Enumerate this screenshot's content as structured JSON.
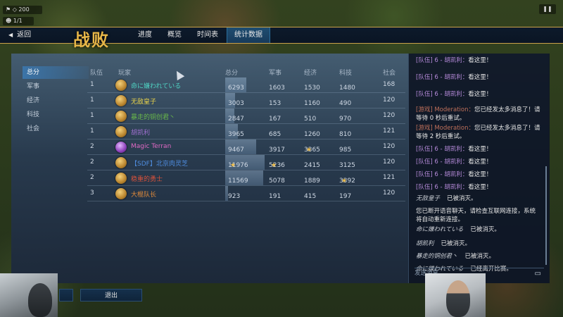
{
  "header": {
    "back_label": "返回",
    "defeat_title": "战败",
    "tabs": [
      {
        "label": "进度",
        "active": false
      },
      {
        "label": "概览",
        "active": false
      },
      {
        "label": "时间表",
        "active": false
      },
      {
        "label": "统计数据",
        "active": true
      }
    ]
  },
  "top_left": {
    "resource1": "200",
    "resource2": "1/1"
  },
  "sidebar": {
    "items": [
      {
        "label": "总分",
        "active": true
      },
      {
        "label": "军事",
        "active": false
      },
      {
        "label": "经济",
        "active": false
      },
      {
        "label": "科技",
        "active": false
      },
      {
        "label": "社会",
        "active": false
      }
    ]
  },
  "table": {
    "headers": {
      "team": "队伍",
      "player": "玩家",
      "total": "总分",
      "military": "军事",
      "economy": "经济",
      "tech": "科技",
      "society": "社会"
    },
    "rows": [
      {
        "team": "1",
        "player": "命に嫌われている",
        "player_color": "#4fd3c3",
        "medal": "gold",
        "total": "6293",
        "total_bar": 0.53,
        "military": "1603",
        "economy": "1530",
        "tech": "1480",
        "society": "168",
        "economy_star": false,
        "military_star": false,
        "tech_star": false,
        "total_star": false
      },
      {
        "team": "1",
        "player": "无敌皇子",
        "player_color": "#e9d34a",
        "medal": "gold",
        "total": "3003",
        "total_bar": 0.25,
        "military": "153",
        "economy": "1160",
        "tech": "490",
        "society": "120",
        "economy_star": false,
        "military_star": false,
        "tech_star": false,
        "total_star": false
      },
      {
        "team": "1",
        "player": "暴走的铜创君丶",
        "player_color": "#69b84a",
        "medal": "gold",
        "total": "2847",
        "total_bar": 0.24,
        "military": "167",
        "economy": "510",
        "tech": "970",
        "society": "120",
        "economy_star": false,
        "military_star": false,
        "tech_star": false,
        "total_star": false
      },
      {
        "team": "1",
        "player": "胡凯利",
        "player_color": "#a06fd0",
        "medal": "gold",
        "total": "3965",
        "total_bar": 0.33,
        "military": "685",
        "economy": "1260",
        "tech": "810",
        "society": "121",
        "economy_star": false,
        "military_star": false,
        "tech_star": false,
        "total_star": false
      },
      {
        "team": "2",
        "player": "Magic Terran",
        "player_color": "#e069c4",
        "medal": "purple",
        "total": "9467",
        "total_bar": 0.79,
        "military": "3917",
        "economy": "3365",
        "tech": "985",
        "society": "120",
        "economy_star": true,
        "military_star": false,
        "tech_star": false,
        "total_star": false
      },
      {
        "team": "2",
        "player": "【SDF】北京肉灵芝",
        "player_color": "#4f8de0",
        "medal": "gold",
        "total": "11976",
        "total_bar": 1.0,
        "military": "5236",
        "economy": "2415",
        "tech": "3125",
        "society": "120",
        "economy_star": false,
        "military_star": true,
        "tech_star": false,
        "total_star": true
      },
      {
        "team": "2",
        "player": "稳重的勇士",
        "player_color": "#d8513b",
        "medal": "gold",
        "total": "11569",
        "total_bar": 0.97,
        "military": "5078",
        "economy": "1889",
        "tech": "3392",
        "society": "121",
        "economy_star": false,
        "military_star": false,
        "tech_star": true,
        "total_star": false
      },
      {
        "team": "3",
        "player": "大棍队长",
        "player_color": "#e08a3a",
        "medal": "gold",
        "total": "923",
        "total_bar": 0.08,
        "military": "191",
        "economy": "415",
        "tech": "197",
        "society": "120",
        "economy_star": false,
        "military_star": false,
        "tech_star": false,
        "total_star": false
      }
    ]
  },
  "chat": {
    "messages": [
      {
        "tag": "[队伍] 6 - 胡凯利：",
        "text": "看这里！",
        "kind": "team"
      },
      {
        "tag": "[队伍] 6 - 胡凯利：",
        "text": "看这里！",
        "kind": "team"
      },
      {
        "tag": "[队伍] 6 - 胡凯利：",
        "text": "看这里！",
        "kind": "team"
      },
      {
        "tag": "[游戏] Moderation：",
        "text": "您已经发太多消息了！请等待 0 秒后重试。",
        "kind": "sys"
      },
      {
        "tag": "[游戏] Moderation：",
        "text": "您已经发太多消息了！请等待 2 秒后重试。",
        "kind": "sys"
      },
      {
        "tag": "[队伍] 6 - 胡凯利：",
        "text": "看这里！",
        "kind": "team"
      },
      {
        "tag": "[队伍] 6 - 胡凯利：",
        "text": "看这里！",
        "kind": "team"
      },
      {
        "tag": "[队伍] 6 - 胡凯利：",
        "text": "看这里！",
        "kind": "team"
      },
      {
        "tag": "[队伍] 6 - 胡凯利：",
        "text": "看这里！",
        "kind": "team"
      },
      {
        "tag": "无敌皇子",
        "text": "已被消灭。",
        "kind": "event"
      },
      {
        "tag": "",
        "text": "您已断开语音聊天，请检查互联网连接，系统将自动重新连接。",
        "kind": "plain"
      },
      {
        "tag": "命に嫌われている",
        "text": "已被消灭。",
        "kind": "event"
      },
      {
        "tag": "胡凯利",
        "text": "已被消灭。",
        "kind": "event"
      },
      {
        "tag": "暴走的铜创君丶",
        "text": "已被消灭。",
        "kind": "event"
      },
      {
        "tag": "命に嫌われている",
        "text": "已经离开比赛。",
        "kind": "event"
      }
    ],
    "input_placeholder": "发送消息..."
  },
  "buttons": {
    "exit_label": "退出"
  }
}
